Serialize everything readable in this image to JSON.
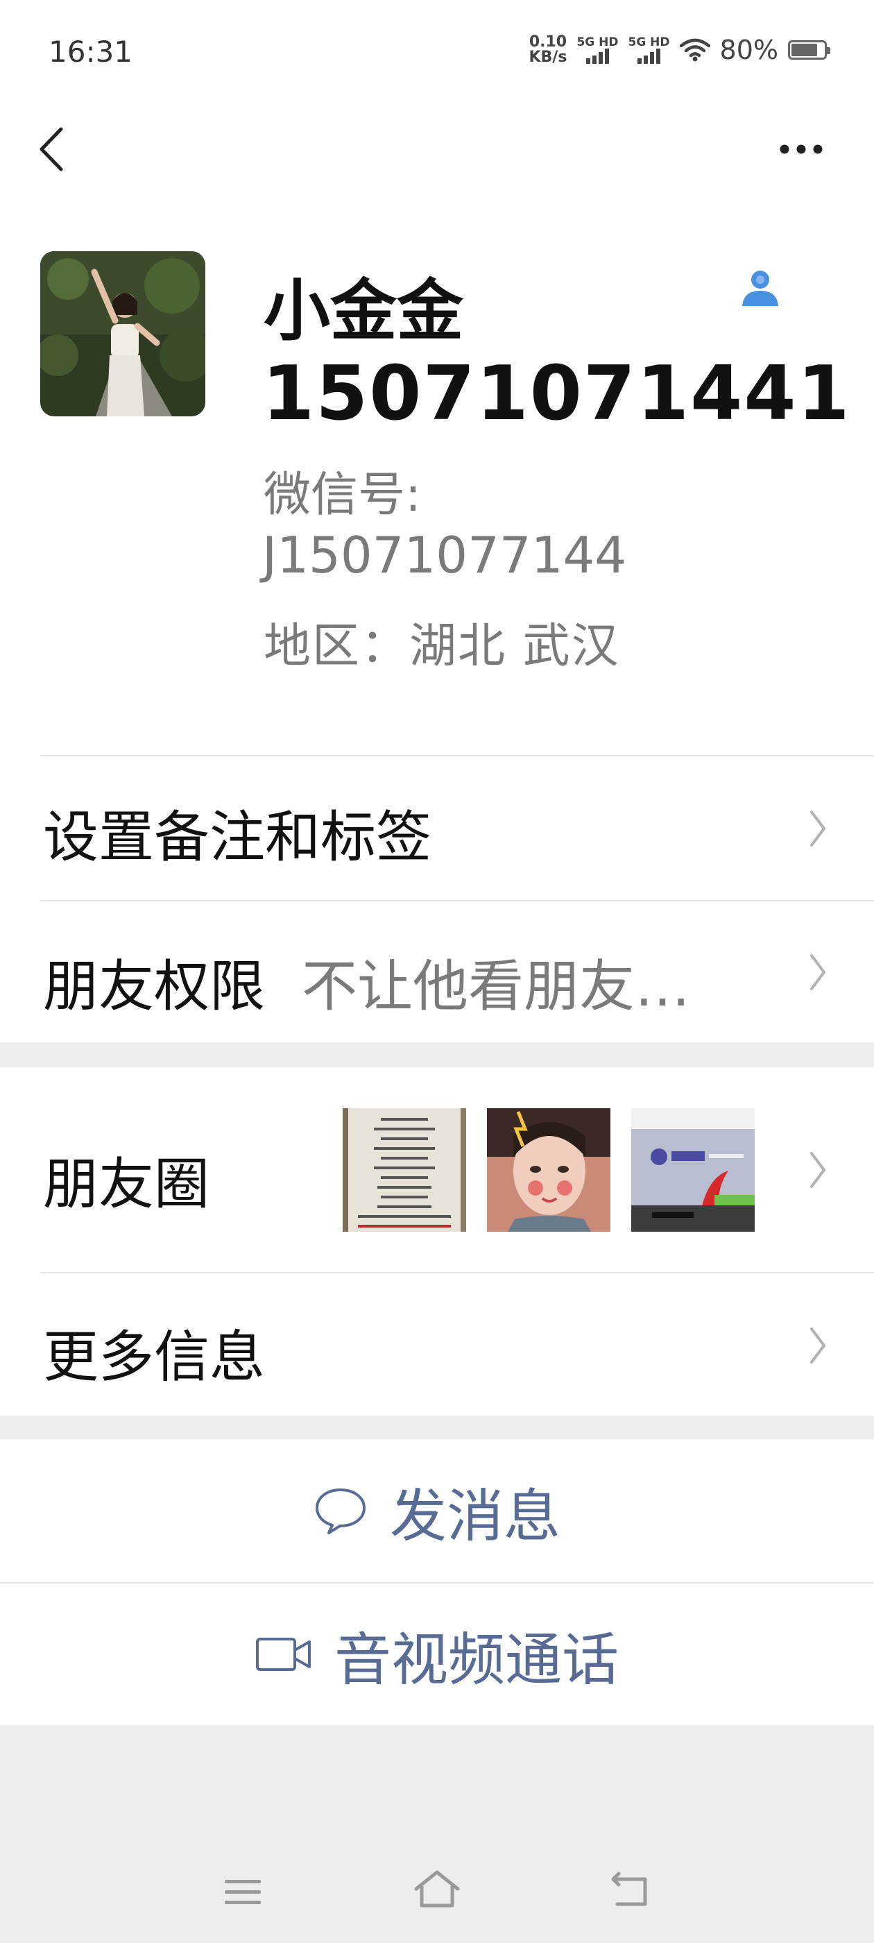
{
  "status_bar": {
    "time": "16:31",
    "net_speed_value": "0.10",
    "net_speed_unit": "KB/s",
    "sim1": "5G HD",
    "sim2": "5G HD",
    "battery": "80%",
    "battery_level": 0.8
  },
  "profile": {
    "name": "小金金",
    "phone": "15071071441",
    "wechat_label": "微信号:",
    "wechat_id": "J15071077144",
    "region": "地区：湖北  武汉"
  },
  "rows": {
    "remark_label": "设置备注和标签",
    "permission_label": "朋友权限",
    "permission_value": "不让他看朋友…",
    "moments_label": "朋友圈",
    "more_info_label": "更多信息"
  },
  "actions": {
    "message_label": "发消息",
    "call_label": "音视频通话"
  },
  "icons": {
    "back": "chevron-left-icon",
    "more": "more-dots-icon",
    "contact": "contact-person-icon",
    "message": "chat-bubble-icon",
    "call": "video-camera-icon"
  },
  "colors": {
    "link_blue": "#576b95",
    "accent_blue": "#4a90e2",
    "background_gray": "#ededed"
  }
}
